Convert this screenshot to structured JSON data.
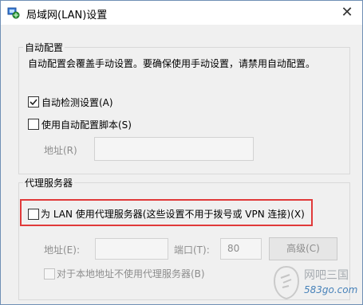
{
  "window": {
    "title": "局域网(LAN)设置",
    "close_glyph": "✕"
  },
  "auto_config": {
    "legend": "自动配置",
    "description": "自动配置会覆盖手动设置。要确保使用手动设置，请禁用自动配置。",
    "auto_detect": {
      "label": "自动检测设置(A)",
      "checked": true
    },
    "use_script": {
      "label": "使用自动配置脚本(S)",
      "checked": false
    },
    "address_label": "地址(R)",
    "address_value": ""
  },
  "proxy": {
    "legend": "代理服务器",
    "use_proxy": {
      "label": "为 LAN 使用代理服务器(这些设置不用于拨号或 VPN 连接)(X)",
      "checked": false
    },
    "address_label": "地址(E):",
    "address_value": "",
    "port_label": "端口(T):",
    "port_value": "80",
    "advanced_button": "高级(C)",
    "bypass_local": {
      "label": "对于本地地址不使用代理服务器(B)",
      "checked": false
    }
  },
  "watermark": {
    "brand": "网吧三国",
    "url": "583go.com"
  },
  "colors": {
    "highlight": "#e03a3a",
    "window_border": "#6f8fb5"
  }
}
